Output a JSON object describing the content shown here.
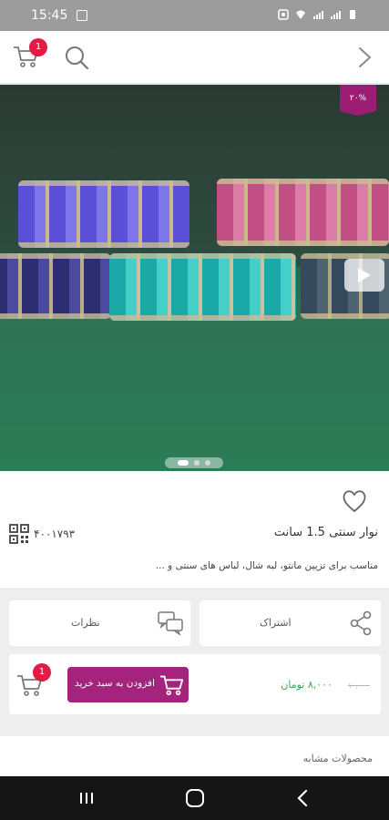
{
  "status_bar": {
    "time": "15:45"
  },
  "header": {
    "cart_badge": "1"
  },
  "hero": {
    "discount": "۲۰%"
  },
  "product": {
    "title": "نوار سنتی 1.5 سانت",
    "code": "۴۰۰۱۷۹۳",
    "description": "مناسب برای تزیین مانتو، لبه شال، لباس های سنتی و ..."
  },
  "actions": {
    "comments_label": "نظرات",
    "share_label": "اشتراک"
  },
  "buy": {
    "button_label": "افزودن به سبد خرید",
    "cart_badge": "1",
    "old_price": "۱۰,۰۰۰",
    "new_price": "۸,۰۰۰ تومان"
  },
  "similar": {
    "label": "محصولات مشابه"
  },
  "colors": {
    "primary": "#a4237c",
    "badge": "#e31c46",
    "price": "#3fa34d",
    "discount_tag": "#9c1d73"
  }
}
